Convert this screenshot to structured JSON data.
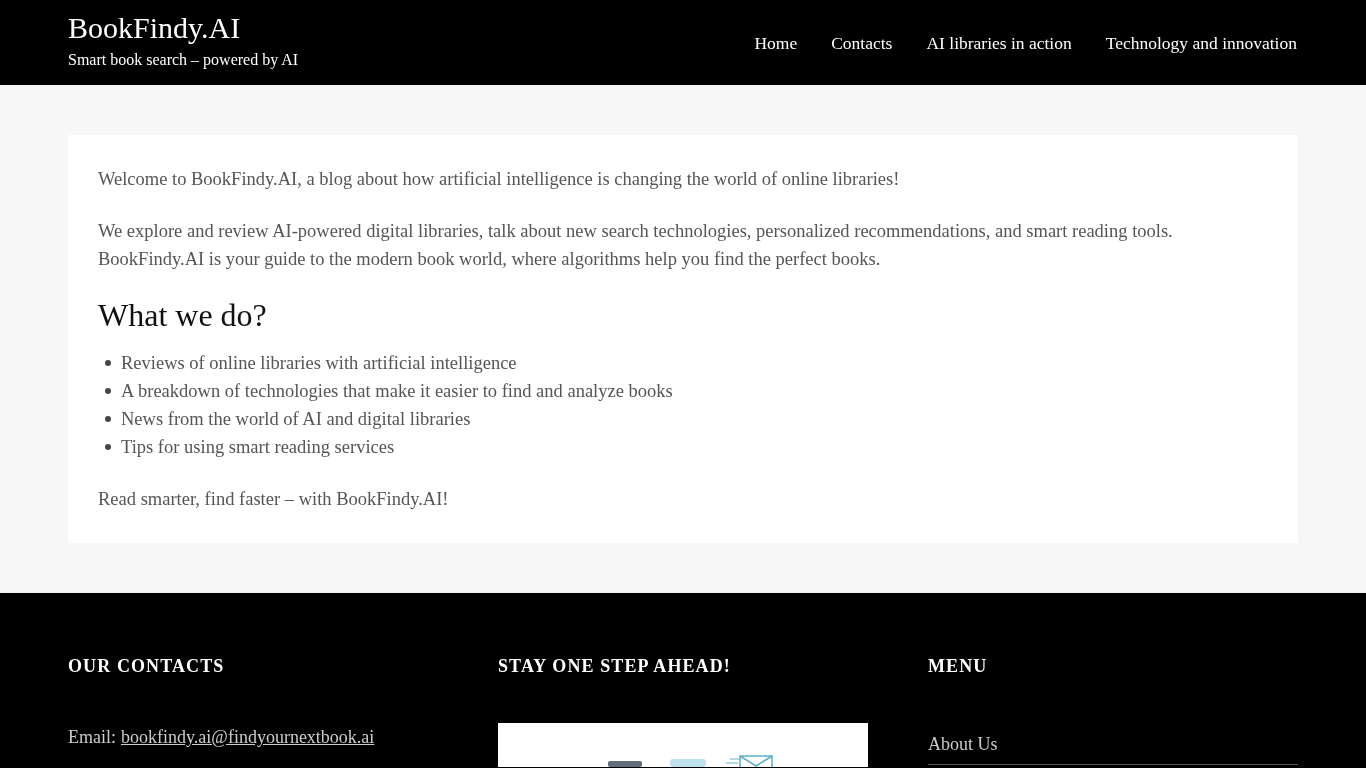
{
  "header": {
    "site_title": "BookFindy.AI",
    "tagline": "Smart book search – powered by AI",
    "nav": [
      {
        "label": "Home"
      },
      {
        "label": "Contacts"
      },
      {
        "label": "AI libraries in action"
      },
      {
        "label": "Technology and innovation"
      }
    ]
  },
  "content": {
    "intro": [
      "Welcome to BookFindy.AI, a blog about how artificial intelligence is changing the world of online libraries!",
      "We explore and review AI-powered digital libraries, talk about new search technologies, personalized recommendations, and smart reading tools. BookFindy.AI is your guide to the modern book world, where algorithms help you find the perfect books."
    ],
    "heading": "What we do?",
    "list": [
      "Reviews of online libraries with artificial intelligence",
      "A breakdown of technologies that make it easier to find and analyze books",
      "News from the world of AI and digital libraries",
      "Tips for using smart reading services"
    ],
    "closing": "Read smarter, find faster – with BookFindy.AI!"
  },
  "footer": {
    "columns": [
      {
        "kind": "contacts",
        "title": "OUR CONTACTS",
        "email_label": "Email:",
        "email": "bookfindy.ai@findyournextbook.ai"
      },
      {
        "kind": "newsletter",
        "title": "STAY ONE STEP AHEAD!"
      },
      {
        "kind": "menu",
        "title": "MENU",
        "items": [
          "About Us"
        ]
      }
    ]
  }
}
